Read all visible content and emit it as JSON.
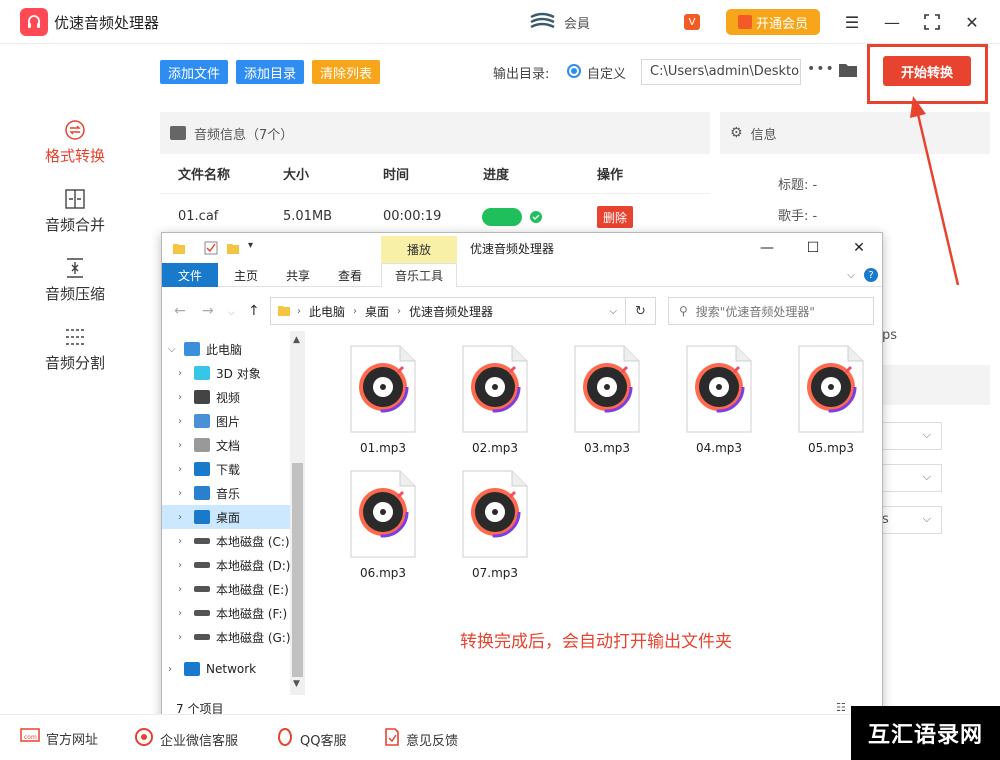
{
  "app": {
    "title": "优速音频处理器",
    "user_name": "会員",
    "vip_label": "开通会员",
    "vip_badge": "V"
  },
  "sidebar": {
    "items": [
      {
        "label": "格式转换",
        "icon": "convert-icon",
        "active": true
      },
      {
        "label": "音频合并",
        "icon": "merge-icon",
        "active": false
      },
      {
        "label": "音频压缩",
        "icon": "compress-icon",
        "active": false
      },
      {
        "label": "音频分割",
        "icon": "split-icon",
        "active": false
      }
    ]
  },
  "toolbar": {
    "add_file": "添加文件",
    "add_dir": "添加目录",
    "clear_list": "清除列表",
    "output_label": "输出目录:",
    "custom_label": "自定义",
    "output_path": "C:\\Users\\admin\\Deskto",
    "more": "•••",
    "start_button": "开始转换"
  },
  "audio_panel": {
    "title": "音频信息（7个）",
    "columns": [
      "文件名称",
      "大小",
      "时间",
      "进度",
      "操作"
    ],
    "rows": [
      {
        "name": "01.caf",
        "size": "5.01MB",
        "time": "00:00:19",
        "progress": 1.0,
        "action": "删除"
      }
    ]
  },
  "info_panel": {
    "title": "信息",
    "title_label": "标题:",
    "title_value": "-",
    "artist_label": "歌手:",
    "artist_value": "-",
    "bitrate_fragment": "ps",
    "select_fragment": "s"
  },
  "explorer": {
    "qa_title": "优速音频处理器",
    "tabs": [
      "文件",
      "主页",
      "共享",
      "查看"
    ],
    "contextual_group": "播放",
    "contextual_tab": "音乐工具",
    "path": [
      "此电脑",
      "桌面",
      "优速音频处理器"
    ],
    "search_placeholder": "搜索\"优速音频处理器\"",
    "tree": [
      {
        "label": "此电脑",
        "level": 0,
        "expanded": true
      },
      {
        "label": "3D 对象",
        "level": 1
      },
      {
        "label": "视频",
        "level": 1
      },
      {
        "label": "图片",
        "level": 1
      },
      {
        "label": "文档",
        "level": 1
      },
      {
        "label": "下载",
        "level": 1
      },
      {
        "label": "音乐",
        "level": 1
      },
      {
        "label": "桌面",
        "level": 1,
        "selected": true
      },
      {
        "label": "本地磁盘 (C:)",
        "level": 1
      },
      {
        "label": "本地磁盘 (D:)",
        "level": 1
      },
      {
        "label": "本地磁盘 (E:)",
        "level": 1
      },
      {
        "label": "本地磁盘 (F:)",
        "level": 1
      },
      {
        "label": "本地磁盘 (G:)",
        "level": 1
      },
      {
        "label": "Network",
        "level": 0
      }
    ],
    "files": [
      "01.mp3",
      "02.mp3",
      "03.mp3",
      "04.mp3",
      "05.mp3",
      "06.mp3",
      "07.mp3"
    ],
    "status": "7 个项目",
    "annotation": "转换完成后，会自动打开输出文件夹"
  },
  "footer": {
    "items": [
      "官方网址",
      "企业微信客服",
      "QQ客服",
      "意见反馈"
    ]
  },
  "watermark": "互汇语录网",
  "colors": {
    "accent_red": "#e8432f",
    "blue": "#2f8df2",
    "orange": "#f7a51b",
    "green": "#1fbf5c",
    "explorer_blue": "#1979ca"
  }
}
